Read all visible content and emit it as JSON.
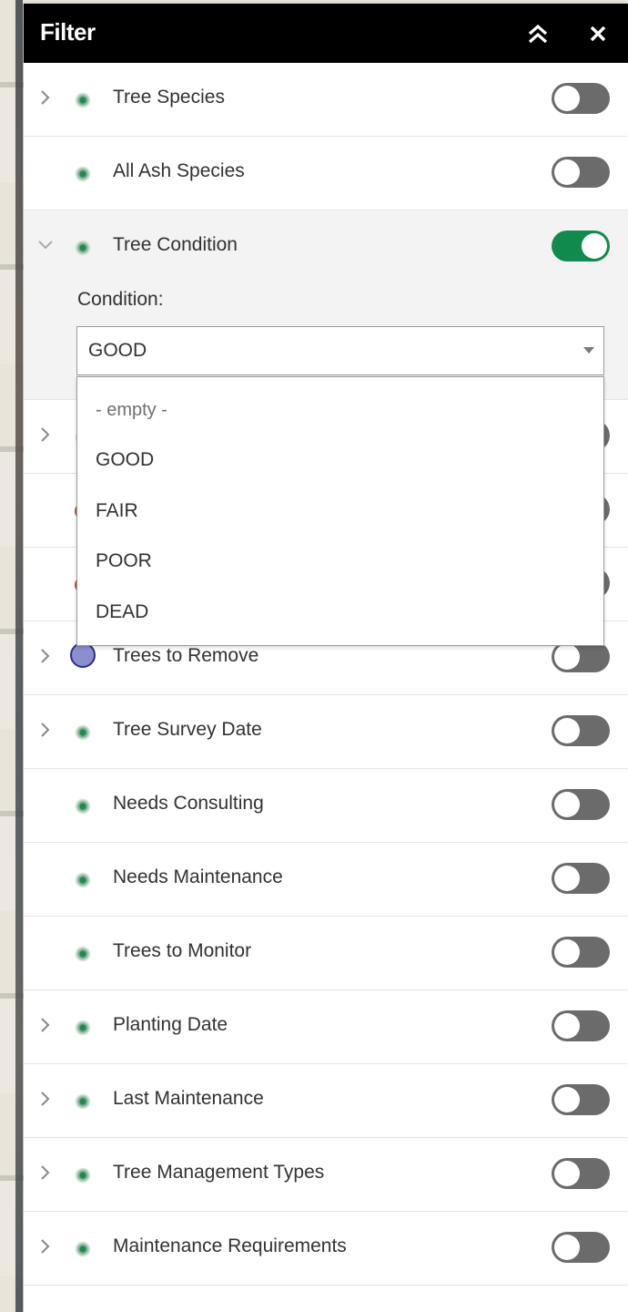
{
  "panel": {
    "title": "Filter",
    "collapse_icon": "double-chevron-up-icon",
    "close_icon": "close-icon"
  },
  "filters": [
    {
      "label": "Tree Species",
      "has_chevron": true,
      "symbol": "green-dot",
      "enabled": false
    },
    {
      "label": "All Ash Species",
      "has_chevron": false,
      "symbol": "green-dot",
      "enabled": false
    },
    {
      "label": "Tree Condition",
      "has_chevron": true,
      "expanded": true,
      "symbol": "green-dot",
      "enabled": true,
      "field_label": "Condition:",
      "selected_value": "GOOD"
    },
    {
      "label": "",
      "has_chevron": true,
      "symbol": "green-dot",
      "enabled": false
    },
    {
      "label": "",
      "has_chevron": false,
      "symbol": "red-dot",
      "enabled": false
    },
    {
      "label": "",
      "has_chevron": false,
      "symbol": "red-dot",
      "enabled": false
    },
    {
      "label": "Trees to Remove",
      "has_chevron": true,
      "symbol": "purple-circle",
      "enabled": false
    },
    {
      "label": "Tree Survey Date",
      "has_chevron": true,
      "symbol": "green-dot",
      "enabled": false
    },
    {
      "label": "Needs Consulting",
      "has_chevron": false,
      "symbol": "green-dot",
      "enabled": false
    },
    {
      "label": "Needs Maintenance",
      "has_chevron": false,
      "symbol": "green-dot",
      "enabled": false
    },
    {
      "label": "Trees to Monitor",
      "has_chevron": false,
      "symbol": "green-dot",
      "enabled": false
    },
    {
      "label": "Planting Date",
      "has_chevron": true,
      "symbol": "green-dot",
      "enabled": false
    },
    {
      "label": "Last Maintenance",
      "has_chevron": true,
      "symbol": "green-dot",
      "enabled": false
    },
    {
      "label": "Tree Management Types",
      "has_chevron": true,
      "symbol": "green-dot",
      "enabled": false
    },
    {
      "label": "Maintenance Requirements",
      "has_chevron": true,
      "symbol": "green-dot",
      "enabled": false
    }
  ],
  "condition_dropdown": {
    "options": [
      "- empty -",
      "GOOD",
      "FAIR",
      "POOR",
      "DEAD"
    ]
  },
  "colors": {
    "header_bg": "#000000",
    "toggle_on": "#118a4d",
    "toggle_off": "#6b6b6b",
    "expanded_bg": "#f3f3f3"
  }
}
